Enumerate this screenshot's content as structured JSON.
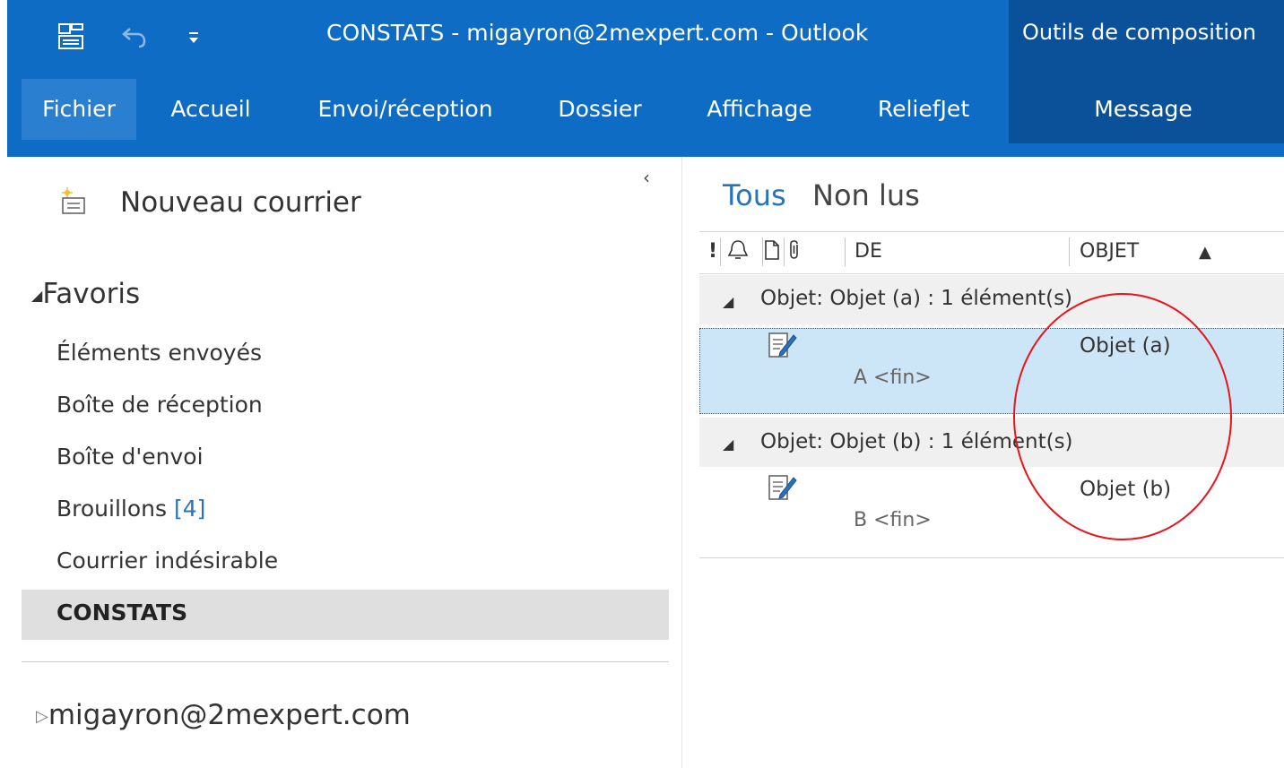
{
  "titlebar": {
    "title": "CONSTATS - migayron@2mexpert.com  -  Outlook",
    "context_group": "Outils de composition"
  },
  "ribbon": {
    "tabs": [
      "Fichier",
      "Accueil",
      "Envoi/réception",
      "Dossier",
      "Affichage",
      "ReliefJet",
      "Message"
    ],
    "active_tab": "Fichier"
  },
  "left_pane": {
    "collapse_symbol": "‹",
    "new_mail_label": "Nouveau courrier",
    "favorites_label": "Favoris",
    "favorites_toggle": "◢",
    "favorites": [
      {
        "label": "Éléments envoyés"
      },
      {
        "label": "Boîte de réception"
      },
      {
        "label": "Boîte d'envoi"
      },
      {
        "label": "Brouillons",
        "count": "[4]"
      },
      {
        "label": "Courrier indésirable"
      },
      {
        "label": "CONSTATS",
        "selected": true
      }
    ],
    "account_toggle": "▷",
    "account_label": "migayron@2mexpert.com"
  },
  "message_list": {
    "filters": {
      "all": "Tous",
      "unread": "Non lus"
    },
    "columns": {
      "importance": "!",
      "from": "DE",
      "subject": "OBJET",
      "sort_arrow": "▲"
    },
    "groups": [
      {
        "header": "Objet: Objet (a) : 1 élément(s)",
        "items": [
          {
            "subject": "Objet (a)",
            "preview": "A <fin>",
            "selected": true
          }
        ]
      },
      {
        "header": "Objet: Objet (b) : 1 élément(s)",
        "items": [
          {
            "subject": "Objet (b)",
            "preview": "B <fin>",
            "selected": false
          }
        ]
      }
    ],
    "group_toggle": "◢"
  },
  "colors": {
    "ribbon_blue": "#0e6cc4",
    "context_blue": "#0a5199",
    "link_blue": "#2b73b8",
    "selection": "#cde6f7",
    "annotation_red": "#e8141b"
  }
}
